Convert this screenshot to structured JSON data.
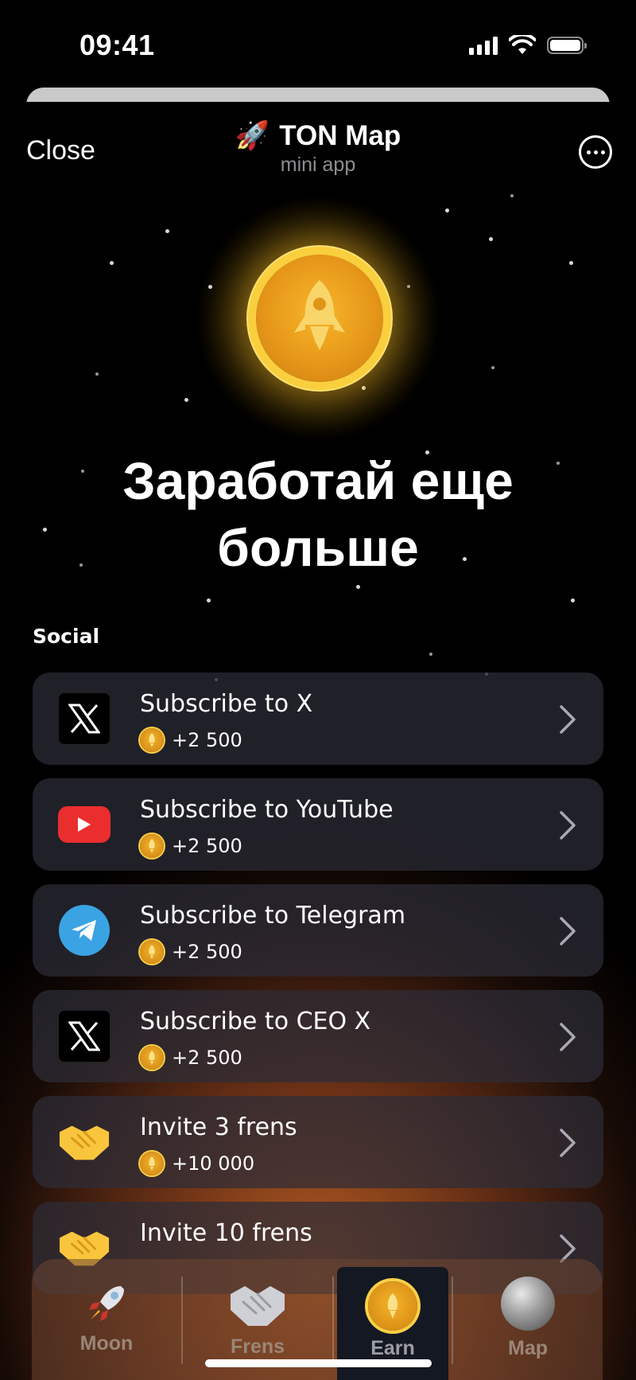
{
  "status_bar": {
    "time": "09:41"
  },
  "header": {
    "close_label": "Close",
    "app_emoji": "🚀",
    "app_title": "TON Map",
    "app_subtitle": "mini app"
  },
  "hero": {
    "line1": "Заработай еще",
    "line2": "больше"
  },
  "section": {
    "label": "Social"
  },
  "tasks": [
    {
      "title": "Subscribe to X",
      "reward": "+2 500",
      "icon": "x-logo-icon"
    },
    {
      "title": "Subscribe to YouTube",
      "reward": "+2 500",
      "icon": "youtube-icon"
    },
    {
      "title": "Subscribe to Telegram",
      "reward": "+2 500",
      "icon": "telegram-icon"
    },
    {
      "title": "Subscribe to CEO X",
      "reward": "+2 500",
      "icon": "x-logo-icon"
    },
    {
      "title": "Invite 3 frens",
      "reward": "+10 000",
      "icon": "handshake-icon"
    },
    {
      "title": "Invite 10 frens",
      "reward": "",
      "icon": "handshake-icon"
    }
  ],
  "nav": [
    {
      "label": "Moon",
      "icon": "rocket-icon",
      "active": false
    },
    {
      "label": "Frens",
      "icon": "handshake-icon",
      "active": false
    },
    {
      "label": "Earn",
      "icon": "coin-icon",
      "active": true
    },
    {
      "label": "Map",
      "icon": "globe-icon",
      "active": false
    }
  ],
  "colors": {
    "coin_gold": "#f7b52a",
    "card_bg": "#2d2d37",
    "youtube_red": "#ea2e2e",
    "telegram_blue": "#3aa3e3"
  }
}
